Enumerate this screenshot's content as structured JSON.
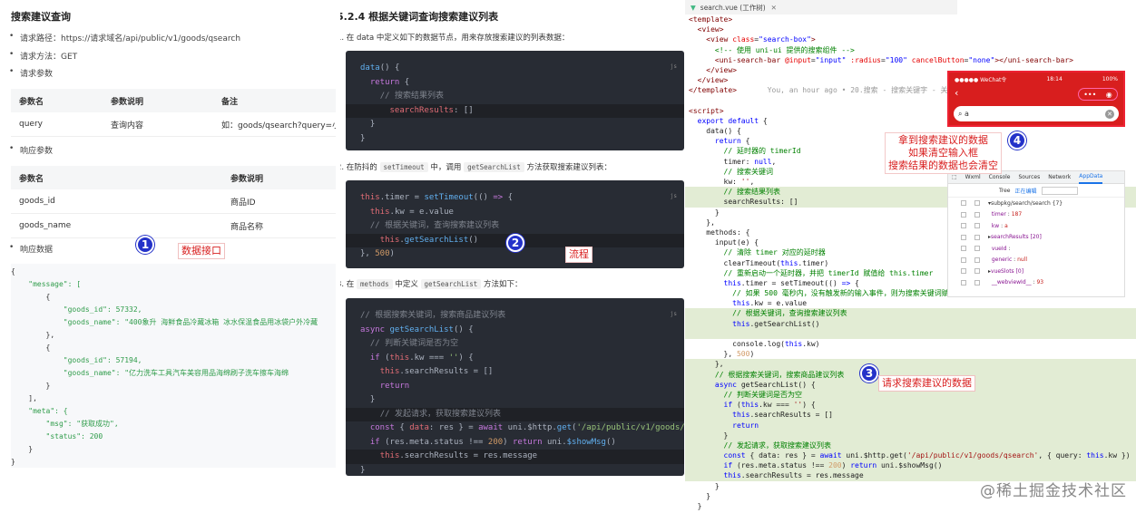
{
  "left": {
    "title": "搜索建议查询",
    "bullets": [
      "请求路径：https://请求域名/api/public/v1/goods/qsearch",
      "请求方法：GET",
      "请求参数",
      "响应参数",
      "响应数据"
    ],
    "table1": {
      "headers": [
        "参数名",
        "参数说明",
        "备注"
      ],
      "rows": [
        [
          "query",
          "查询内容",
          "如：goods/qsearch?query=小米"
        ]
      ]
    },
    "table2": {
      "headers": [
        "参数名",
        "参数说明"
      ],
      "rows": [
        [
          "goods_id",
          "商品ID"
        ],
        [
          "goods_name",
          "商品名称"
        ]
      ]
    },
    "badge": "1",
    "label": "数据接口",
    "json_lines": [
      "{",
      "    \"message\": [",
      "        {",
      "            \"goods_id\": 57332,",
      "            \"goods_name\": \"400象升 海鲜食品冷藏冰箱 冰水保温食品用冰袋户外冷藏",
      "        },",
      "        {",
      "            \"goods_id\": 57194,",
      "            \"goods_name\": \"亿力洗车工具汽车美容用品海绵刷子洗车擦车海绵",
      "        }",
      "    ],",
      "    \"meta\": {",
      "        \"msg\": \"获取成功\",",
      "        \"status\": 200",
      "    }",
      "}"
    ]
  },
  "middle": {
    "heading": "5.2.4 根据关键词查询搜索建议列表",
    "step1": "1. 在 data 中定义如下的数据节点，用来存放搜索建议的列表数据：",
    "step2_pre": "2. 在防抖的",
    "step2_code1": "setTimeout",
    "step2_mid": "中，调用",
    "step2_code2": "getSearchList",
    "step2_post": "方法获取搜索建议列表：",
    "step3_pre": "3. 在",
    "step3_code1": "methods",
    "step3_mid": "中定义",
    "step3_code2": "getSearchList",
    "step3_post": "方法如下：",
    "js_tag": "js",
    "badge": "2",
    "label": "流程"
  },
  "right": {
    "tab": "search.vue (工作树)",
    "badge3": "3",
    "label3": "请求搜索建议的数据",
    "badge4": "4",
    "note4": [
      "拿到搜索建议的数据",
      "如果清空输入框",
      "搜索结果的数据也会清空"
    ],
    "phone": {
      "carrier": "●●●●● WeChat令",
      "time": "18:14",
      "battery": "100%",
      "query": "a"
    },
    "devtools": {
      "tabs": [
        "Wxml",
        "Console",
        "Sources",
        "Network",
        "AppData"
      ],
      "active": "AppData",
      "tree": "Tree",
      "editing": "正在编辑",
      "rows": [
        {
          "k": "subpkg/search/search {7}",
          "v": ""
        },
        {
          "k": "timer",
          "v": "187"
        },
        {
          "k": "kw",
          "v": "a"
        },
        {
          "k": "searchResults [20]",
          "v": ""
        },
        {
          "k": "vueId",
          "v": ""
        },
        {
          "k": "generic",
          "v": "null"
        },
        {
          "k": "vueSlots [0]",
          "v": ""
        },
        {
          "k": "__webviewId__",
          "v": "93"
        }
      ]
    }
  },
  "watermark": "@稀土掘金技术社区"
}
